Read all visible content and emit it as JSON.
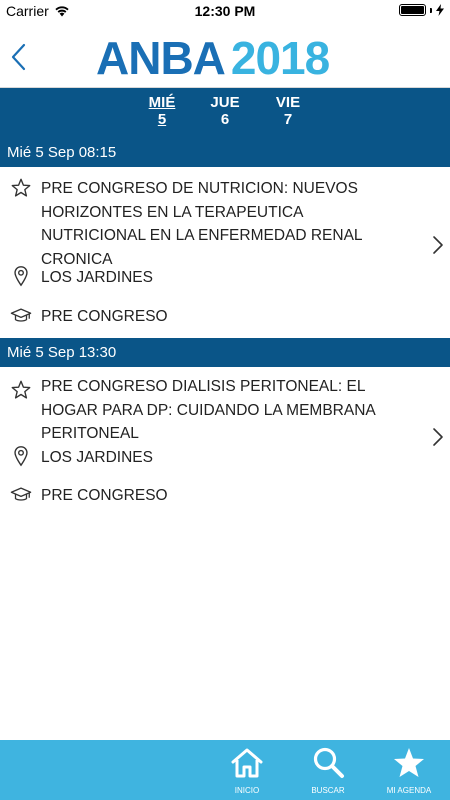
{
  "status_bar": {
    "carrier": "Carrier",
    "time": "12:30 PM"
  },
  "header": {
    "logo_main": "ANBA",
    "logo_year": "2018"
  },
  "day_tabs": [
    {
      "day": "MIÉ",
      "num": "5",
      "active": true
    },
    {
      "day": "JUE",
      "num": "6",
      "active": false
    },
    {
      "day": "VIE",
      "num": "7",
      "active": false
    }
  ],
  "sessions": [
    {
      "datetime": "Mié 5 Sep 08:15",
      "title": "PRE CONGRESO DE NUTRICION: NUEVOS HORIZONTES EN LA TERAPEUTICA NUTRICIONAL EN LA ENFERMEDAD RENAL CRONICA",
      "location": "LOS JARDINES",
      "type": "PRE CONGRESO"
    },
    {
      "datetime": "Mié 5 Sep 13:30",
      "title": "PRE CONGRESO DIALISIS PERITONEAL: EL HOGAR PARA DP: CUIDANDO LA MEMBRANA PERITONEAL",
      "location": "LOS JARDINES",
      "type": "PRE CONGRESO"
    }
  ],
  "bottom_nav": [
    {
      "label": "INICIO",
      "icon": "home-icon"
    },
    {
      "label": "BUSCAR",
      "icon": "search-icon"
    },
    {
      "label": "MI AGENDA",
      "icon": "star-icon"
    }
  ],
  "colors": {
    "primary_dark": "#0a5588",
    "accent": "#3fb4e0",
    "logo_blue": "#1a6fb5"
  }
}
